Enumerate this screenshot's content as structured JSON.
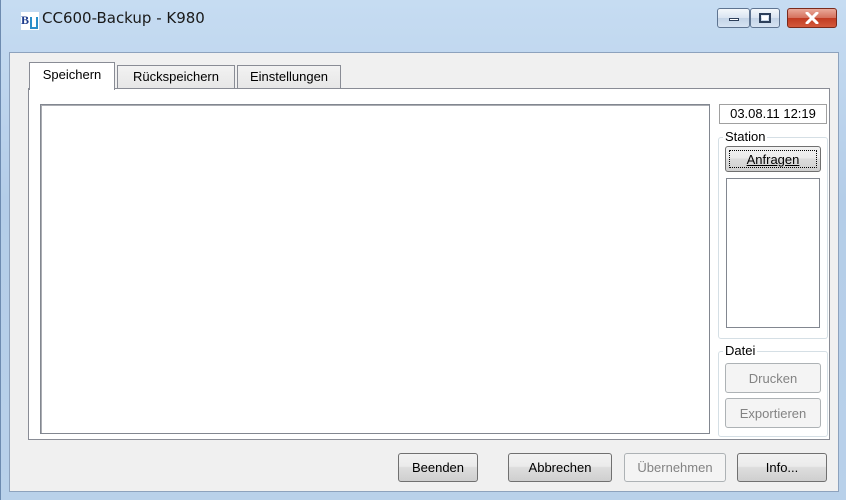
{
  "window": {
    "title": "CC600-Backup - K980",
    "icon": "bu-app-icon"
  },
  "caption_buttons": {
    "minimize_icon": "minimize-icon",
    "maximize_icon": "maximize-icon",
    "close_icon": "close-icon"
  },
  "tabs": [
    {
      "label": "Speichern",
      "active": true
    },
    {
      "label": "Rückspeichern",
      "active": false
    },
    {
      "label": "Einstellungen",
      "active": false
    }
  ],
  "panel": {
    "datetime": "03.08.11 12:19",
    "station": {
      "label": "Station",
      "query_button": "Anfragen"
    },
    "file": {
      "label": "Datei",
      "print_button": "Drucken",
      "export_button": "Exportieren"
    }
  },
  "footer": {
    "exit_button": "Beenden",
    "cancel_button": "Abbrechen",
    "apply_button": "Übernehmen",
    "info_button": "Info..."
  }
}
